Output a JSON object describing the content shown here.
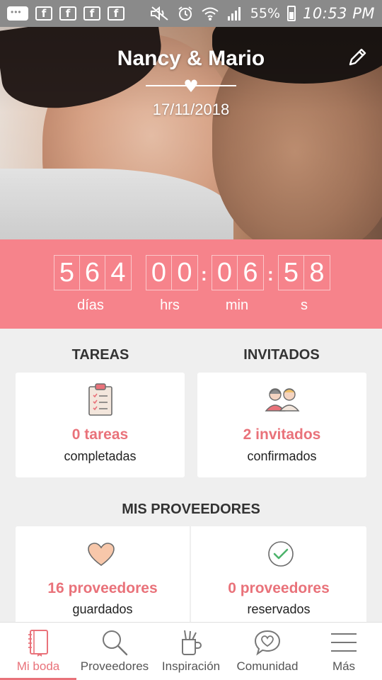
{
  "status_bar": {
    "battery_percent": "55%",
    "time": "10:53 PM",
    "icons": [
      "message-icon",
      "facebook-icon",
      "facebook-icon",
      "facebook-icon",
      "facebook-icon",
      "mute-icon",
      "alarm-icon",
      "wifi-icon",
      "signal-icon",
      "battery-icon"
    ]
  },
  "hero": {
    "couple_names": "Nancy & Mario",
    "wedding_date": "17/11/2018"
  },
  "countdown": {
    "days_digits": [
      "5",
      "6",
      "4"
    ],
    "hours_digits": [
      "0",
      "0"
    ],
    "minutes_digits": [
      "0",
      "6"
    ],
    "seconds_digits": [
      "5",
      "8"
    ],
    "labels": {
      "days": "días",
      "hours": "hrs",
      "minutes": "min",
      "seconds": "s"
    }
  },
  "tasks": {
    "title": "TAREAS",
    "count": "0 tareas",
    "sub": "completadas"
  },
  "guests": {
    "title": "INVITADOS",
    "count": "2 invitados",
    "sub": "confirmados"
  },
  "vendors": {
    "title": "MIS PROVEEDORES",
    "saved_count": "16 proveedores",
    "saved_sub": "guardados",
    "booked_count": "0 proveedores",
    "booked_sub": "reservados"
  },
  "bottom_nav": {
    "items": [
      {
        "label": "Mi boda",
        "icon": "notebook-icon",
        "active": true
      },
      {
        "label": "Proveedores",
        "icon": "search-icon",
        "active": false
      },
      {
        "label": "Inspiración",
        "icon": "pencil-cup-icon",
        "active": false
      },
      {
        "label": "Comunidad",
        "icon": "chat-heart-icon",
        "active": false
      },
      {
        "label": "Más",
        "icon": "menu-icon",
        "active": false
      }
    ]
  },
  "colors": {
    "accent": "#f6838b",
    "accent_text": "#e9727a",
    "status_bar": "#8a8a8a"
  }
}
